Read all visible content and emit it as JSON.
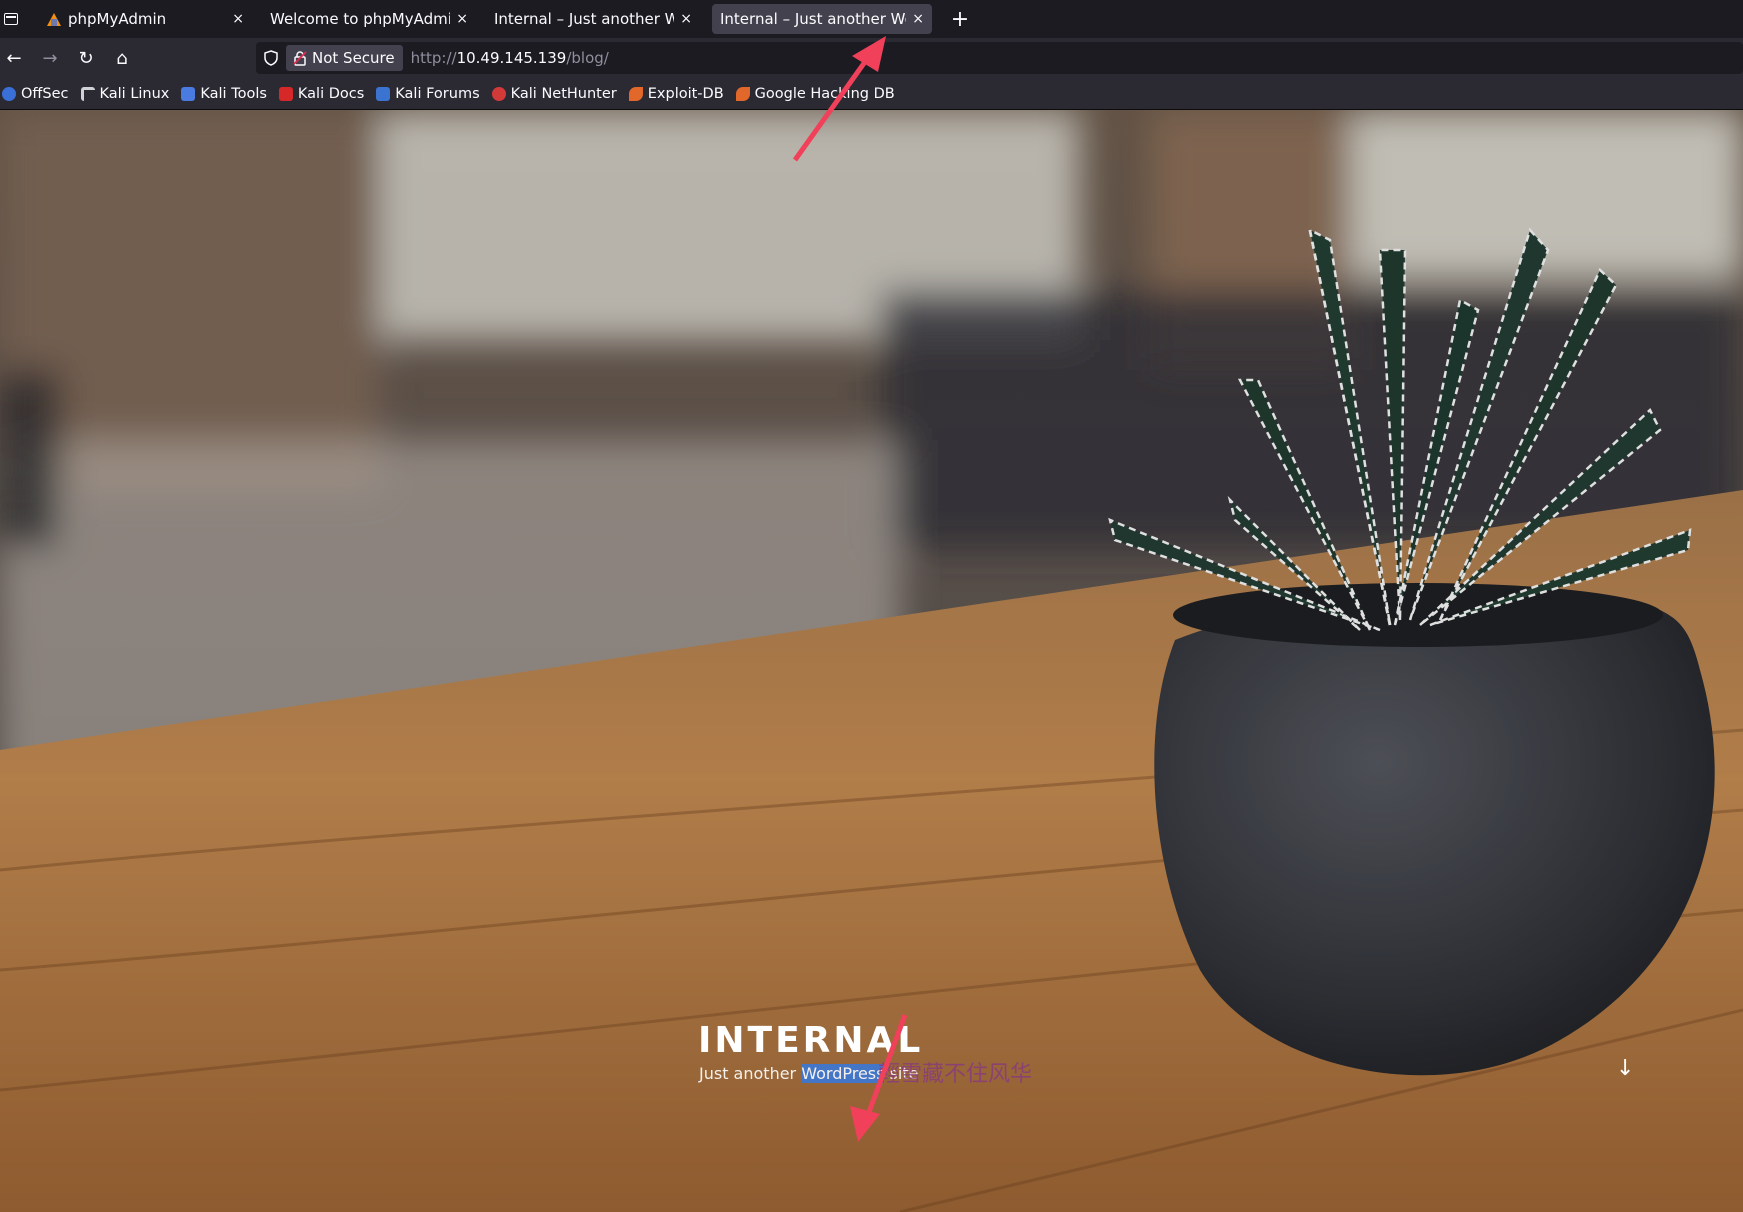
{
  "browser": {
    "tabs": [
      {
        "title": "phpMyAdmin",
        "active": false,
        "favicon": "phpmyadmin-icon"
      },
      {
        "title": "Welcome to phpMyAdmin's d",
        "active": false
      },
      {
        "title": "Internal – Just another WordP",
        "active": false
      },
      {
        "title": "Internal – Just another WordP",
        "active": true
      }
    ],
    "close_glyph": "×",
    "new_tab_glyph": "+",
    "nav": {
      "back": "←",
      "forward": "→",
      "reload": "↻",
      "home": "⌂"
    },
    "security_label": "Not Secure",
    "url_prefix": "http://",
    "url_host": "10.49.145.139",
    "url_path": "/blog/",
    "bookmarks": [
      {
        "label": "OffSec",
        "color": "#3b6fd8"
      },
      {
        "label": "Kali Linux",
        "color": "#cfd2d6"
      },
      {
        "label": "Kali Tools",
        "color": "#4a7be0"
      },
      {
        "label": "Kali Docs",
        "color": "#d62828"
      },
      {
        "label": "Kali Forums",
        "color": "#3a73d0"
      },
      {
        "label": "Kali NetHunter",
        "color": "#d23a3a"
      },
      {
        "label": "Exploit-DB",
        "color": "#e2672a"
      },
      {
        "label": "Google Hacking DB",
        "color": "#e2672a"
      }
    ]
  },
  "site": {
    "title": "INTERNAL",
    "tagline_before": "Just another ",
    "tagline_highlight": "WordPress",
    "tagline_after": " site",
    "scroll_glyph": "↓"
  },
  "overlay": {
    "watermark": "輕雪藏不住风华",
    "arrow_color": "#f0405a"
  }
}
